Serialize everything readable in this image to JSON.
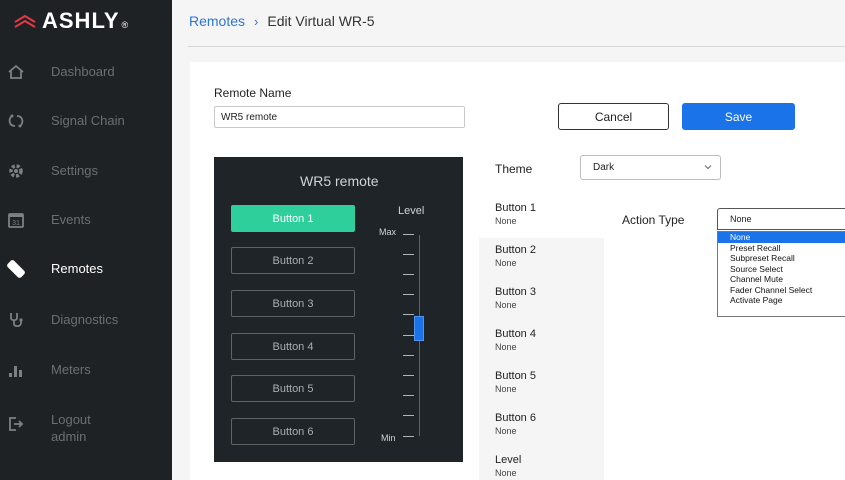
{
  "brand": {
    "name": "ASHLY",
    "accent": "#e63946"
  },
  "colors": {
    "primary": "#1a73e8",
    "selected_button": "#2ecf9b",
    "sidebar_bg": "#1f2225"
  },
  "sidebar": {
    "items": [
      {
        "label": "Dashboard",
        "icon": "home-icon"
      },
      {
        "label": "Signal Chain",
        "icon": "signal-chain-icon"
      },
      {
        "label": "Settings",
        "icon": "gear-icon"
      },
      {
        "label": "Events",
        "icon": "calendar-icon",
        "icon_text": "31"
      },
      {
        "label": "Remotes",
        "icon": "remote-icon",
        "active": true
      },
      {
        "label": "Diagnostics",
        "icon": "stethoscope-icon"
      },
      {
        "label": "Meters",
        "icon": "meters-icon"
      },
      {
        "label": "Logout",
        "sublabel": "admin",
        "icon": "logout-icon"
      }
    ]
  },
  "breadcrumb": {
    "parent": "Remotes",
    "separator": "›",
    "current": "Edit Virtual WR-5"
  },
  "form": {
    "remote_name_label": "Remote Name",
    "remote_name_value": "WR5 remote",
    "cancel_label": "Cancel",
    "save_label": "Save"
  },
  "remote": {
    "title": "WR5 remote",
    "buttons": [
      "Button 1",
      "Button 2",
      "Button 3",
      "Button 4",
      "Button 5",
      "Button 6"
    ],
    "selected_index": 0,
    "level_label": "Level",
    "max_label": "Max",
    "min_label": "Min"
  },
  "theme": {
    "label": "Theme",
    "value": "Dark"
  },
  "button_list": [
    {
      "title": "Button 1",
      "value": "None",
      "selected": true
    },
    {
      "title": "Button 2",
      "value": "None"
    },
    {
      "title": "Button 3",
      "value": "None"
    },
    {
      "title": "Button 4",
      "value": "None"
    },
    {
      "title": "Button 5",
      "value": "None"
    },
    {
      "title": "Button 6",
      "value": "None"
    },
    {
      "title": "Level",
      "value": "None"
    }
  ],
  "action": {
    "label": "Action Type",
    "value": "None",
    "options": [
      "None",
      "Preset Recall",
      "Subpreset Recall",
      "Source Select",
      "Channel Mute",
      "Fader Channel Select",
      "Activate Page"
    ],
    "highlighted_index": 0
  }
}
